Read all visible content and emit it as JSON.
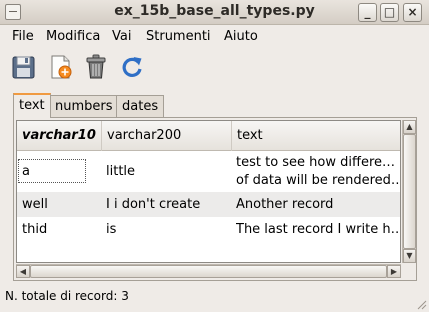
{
  "window": {
    "title": "ex_15b_base_all_types.py",
    "minimize_glyph": "_",
    "maximize_glyph": "□",
    "close_glyph": "×"
  },
  "menu": [
    "File",
    "Modifica",
    "Vai",
    "Strumenti",
    "Aiuto"
  ],
  "toolbar": {
    "icons": [
      "save-icon",
      "new-document-icon",
      "delete-trash-icon",
      "refresh-icon"
    ]
  },
  "tabs": [
    {
      "label": "text",
      "active": true
    },
    {
      "label": "numbers",
      "active": false
    },
    {
      "label": "dates",
      "active": false
    }
  ],
  "table": {
    "columns": [
      "varchar10",
      "varchar200",
      "text"
    ],
    "rows": [
      {
        "varchar10": "a",
        "varchar200": "little",
        "text_line1": "test to see how differe…",
        "text_line2": "of data will be rendered…"
      },
      {
        "varchar10": "well",
        "varchar200": "I i don't create",
        "text_line1": "Another record"
      },
      {
        "varchar10": "thid",
        "varchar200": "is",
        "text_line1": "The last record I write h…"
      }
    ]
  },
  "status": {
    "text": "N. totale di record: 3"
  },
  "colors": {
    "active_tab_accent": "#f09a41",
    "window_background": "#efebe7",
    "alt_row": "#ecebea"
  }
}
